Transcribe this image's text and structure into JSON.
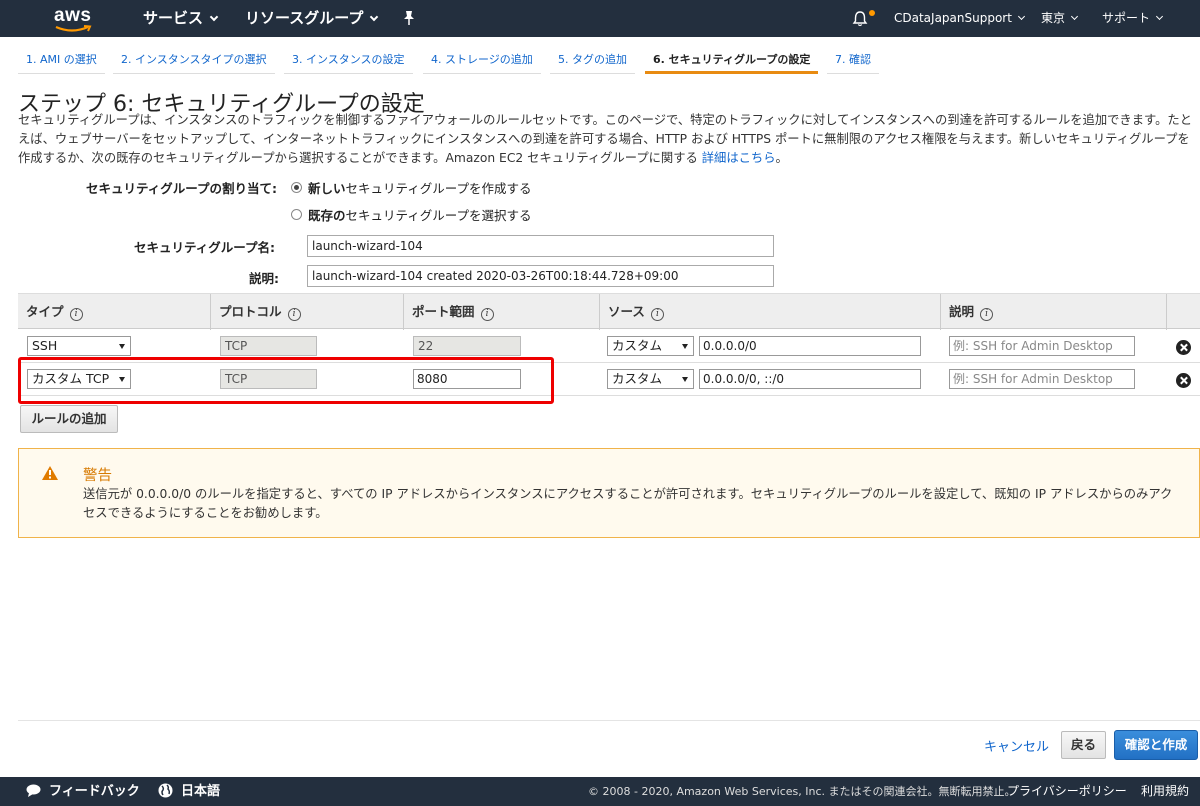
{
  "topnav": {
    "logo": "aws",
    "services": "サービス",
    "resource_groups": "リソースグループ",
    "account": "CDataJapanSupport",
    "region": "東京",
    "support": "サポート"
  },
  "tabs": [
    {
      "label": "1. AMI の選択"
    },
    {
      "label": "2. インスタンスタイプの選択"
    },
    {
      "label": "3. インスタンスの設定"
    },
    {
      "label": "4. ストレージの追加"
    },
    {
      "label": "5. タグの追加"
    },
    {
      "label": "6. セキュリティグループの設定"
    },
    {
      "label": "7. 確認"
    }
  ],
  "active_tab_index": 5,
  "page": {
    "title": "ステップ 6: セキュリティグループの設定",
    "description": "セキュリティグループは、インスタンスのトラフィックを制御するファイアウォールのルールセットです。このページで、特定のトラフィックに対してインスタンスへの到達を許可するルールを追加できます。たとえば、ウェブサーバーをセットアップして、インターネットトラフィックにインスタンスへの到達を許可する場合、HTTP および HTTPS ポートに無制限のアクセス権限を与えます。新しいセキュリティグループを作成するか、次の既存のセキュリティグループから選択することができます。Amazon EC2 セキュリティグループに関する ",
    "description_link": "詳細はこちら",
    "description_end": "。"
  },
  "form": {
    "assign_label": "セキュリティグループの割り当て:",
    "option_new_bold": "新しい",
    "option_new_rest": "セキュリティグループを作成する",
    "option_existing_bold": "既存の",
    "option_existing_rest": "セキュリティグループを選択する",
    "name_label": "セキュリティグループ名:",
    "name_value": "launch-wizard-104",
    "desc_label": "説明:",
    "desc_value": "launch-wizard-104 created 2020-03-26T00:18:44.728+09:00"
  },
  "rules_table": {
    "headers": {
      "type": "タイプ",
      "protocol": "プロトコル",
      "port_range": "ポート範囲",
      "source": "ソース",
      "description": "説明"
    },
    "info_glyph": "i",
    "rows": [
      {
        "type": "SSH",
        "protocol": "TCP",
        "port": "22",
        "source_type": "カスタム",
        "source_cidr": "0.0.0.0/0",
        "description_placeholder": "例: SSH for Admin Desktop"
      },
      {
        "type": "カスタム TCP",
        "protocol": "TCP",
        "port": "8080",
        "source_type": "カスタム",
        "source_cidr": "0.0.0.0/0, ::/0",
        "description_placeholder": "例: SSH for Admin Desktop"
      }
    ],
    "add_rule": "ルールの追加"
  },
  "warning": {
    "title": "警告",
    "text": "送信元が 0.0.0.0/0 のルールを指定すると、すべての IP アドレスからインスタンスにアクセスすることが許可されます。セキュリティグループのルールを設定して、既知の IP アドレスからのみアクセスできるようにすることをお勧めします。"
  },
  "actions": {
    "cancel": "キャンセル",
    "back": "戻る",
    "review_launch": "確認と作成"
  },
  "footer": {
    "feedback": "フィードバック",
    "language": "日本語",
    "copyright": "© 2008 - 2020, Amazon Web Services, Inc. またはその関連会社。無断転用禁止。",
    "privacy": "プライバシーポリシー",
    "terms": "利用規約"
  },
  "colors": {
    "nav_bg": "#232f3e",
    "accent_orange": "#e88b12",
    "link_blue": "#1166cc",
    "primary_button": "#2270c4",
    "highlight_red": "#e00000",
    "warning_border": "#f0b34a"
  }
}
